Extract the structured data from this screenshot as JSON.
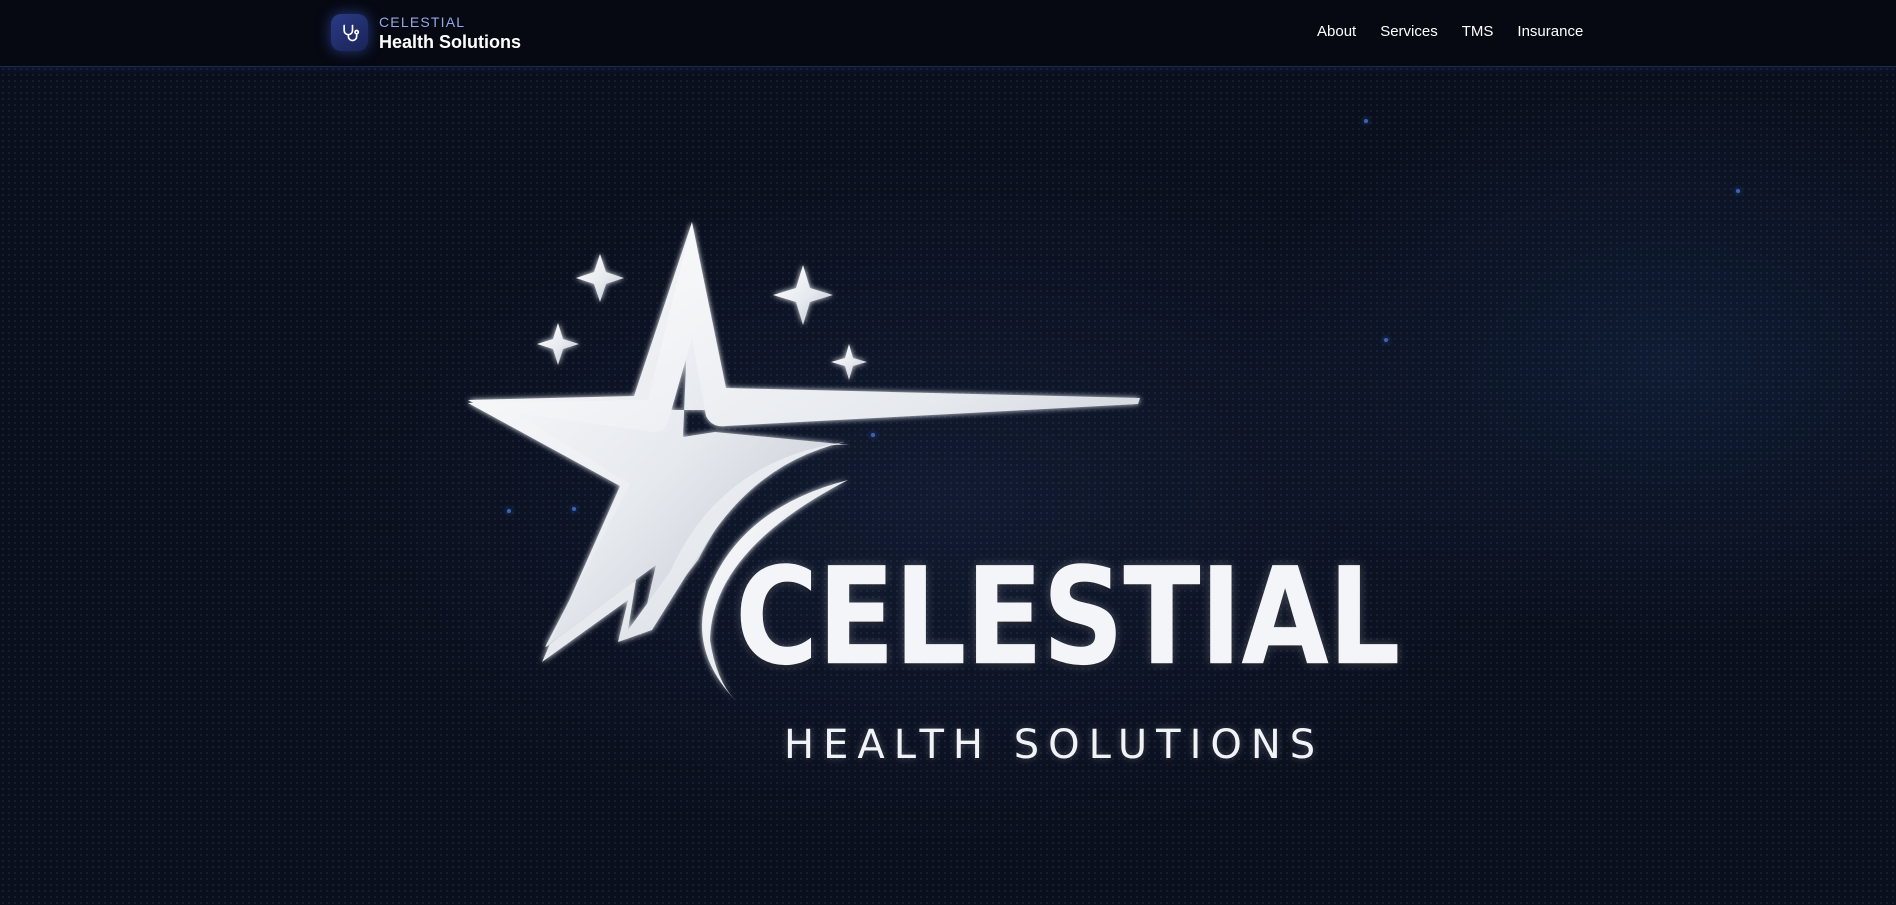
{
  "header": {
    "brand": {
      "icon": "stethoscope-icon",
      "top_label": "CELESTIAL",
      "bottom_label": "Health Solutions"
    },
    "nav": [
      {
        "label": "About"
      },
      {
        "label": "Services"
      },
      {
        "label": "TMS"
      },
      {
        "label": "Insurance"
      }
    ]
  },
  "hero": {
    "logo_icon": "shooting-star-logo",
    "logo_title": "CELESTIAL",
    "logo_subtitle": "HEALTH SOLUTIONS"
  },
  "colors": {
    "background": "#0a0f1d",
    "header_background": "#060912",
    "brand_accent": "#2a3a86",
    "brand_label": "#93a8e6",
    "text": "#ffffff"
  }
}
